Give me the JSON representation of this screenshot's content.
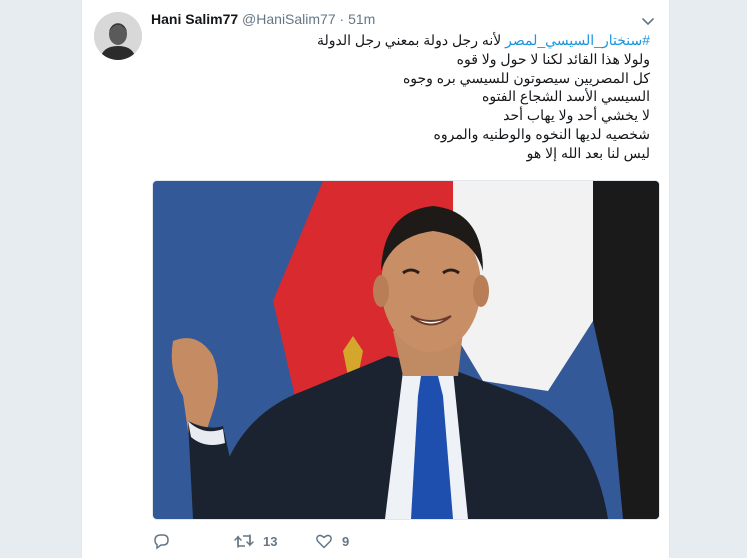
{
  "tweet": {
    "display_name": "Hani Salim77",
    "handle": "@HaniSalim77",
    "separator": "·",
    "time": "51m",
    "hashtag": "#سنختار_السيسي_لمصر",
    "line1_rest": "لأنه رجل دولة  بمعني رجل الدولة",
    "lines": [
      "ولولا هذا القائد لكنا لا حول ولا قوه",
      "كل المصريين سيصوتون للسيسي بره وجوه",
      "السيسي الأسد الشجاع الفتوه",
      "لا يخشي أحد ولا يهاب أحد",
      "شخصيه لديها النخوه والوطنيه والمروه",
      "ليس لنا بعد الله إلا هو"
    ]
  },
  "actions": {
    "reply_count": "",
    "retweet_count": "13",
    "like_count": "9"
  },
  "colors": {
    "accent": "#1b95e0",
    "muted": "#657786",
    "text": "#14171a",
    "background": "#e6ecf0"
  },
  "icons": [
    "chevron-down-icon",
    "reply-icon",
    "retweet-icon",
    "like-icon"
  ]
}
